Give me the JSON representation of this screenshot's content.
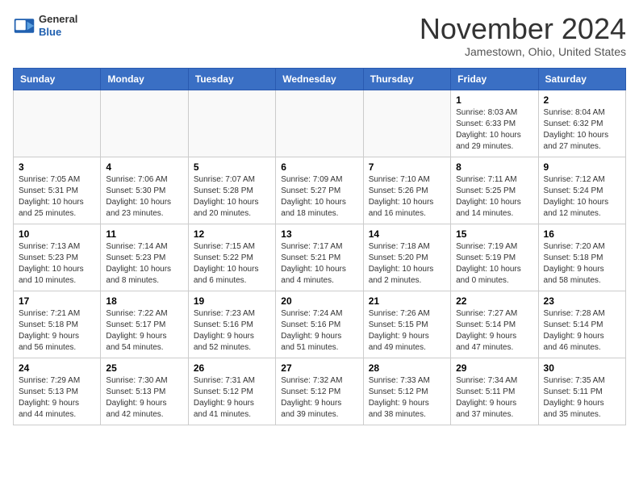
{
  "header": {
    "logo_line1": "General",
    "logo_line2": "Blue",
    "month": "November 2024",
    "location": "Jamestown, Ohio, United States"
  },
  "days_of_week": [
    "Sunday",
    "Monday",
    "Tuesday",
    "Wednesday",
    "Thursday",
    "Friday",
    "Saturday"
  ],
  "weeks": [
    [
      {
        "day": "",
        "info": ""
      },
      {
        "day": "",
        "info": ""
      },
      {
        "day": "",
        "info": ""
      },
      {
        "day": "",
        "info": ""
      },
      {
        "day": "",
        "info": ""
      },
      {
        "day": "1",
        "info": "Sunrise: 8:03 AM\nSunset: 6:33 PM\nDaylight: 10 hours\nand 29 minutes."
      },
      {
        "day": "2",
        "info": "Sunrise: 8:04 AM\nSunset: 6:32 PM\nDaylight: 10 hours\nand 27 minutes."
      }
    ],
    [
      {
        "day": "3",
        "info": "Sunrise: 7:05 AM\nSunset: 5:31 PM\nDaylight: 10 hours\nand 25 minutes."
      },
      {
        "day": "4",
        "info": "Sunrise: 7:06 AM\nSunset: 5:30 PM\nDaylight: 10 hours\nand 23 minutes."
      },
      {
        "day": "5",
        "info": "Sunrise: 7:07 AM\nSunset: 5:28 PM\nDaylight: 10 hours\nand 20 minutes."
      },
      {
        "day": "6",
        "info": "Sunrise: 7:09 AM\nSunset: 5:27 PM\nDaylight: 10 hours\nand 18 minutes."
      },
      {
        "day": "7",
        "info": "Sunrise: 7:10 AM\nSunset: 5:26 PM\nDaylight: 10 hours\nand 16 minutes."
      },
      {
        "day": "8",
        "info": "Sunrise: 7:11 AM\nSunset: 5:25 PM\nDaylight: 10 hours\nand 14 minutes."
      },
      {
        "day": "9",
        "info": "Sunrise: 7:12 AM\nSunset: 5:24 PM\nDaylight: 10 hours\nand 12 minutes."
      }
    ],
    [
      {
        "day": "10",
        "info": "Sunrise: 7:13 AM\nSunset: 5:23 PM\nDaylight: 10 hours\nand 10 minutes."
      },
      {
        "day": "11",
        "info": "Sunrise: 7:14 AM\nSunset: 5:23 PM\nDaylight: 10 hours\nand 8 minutes."
      },
      {
        "day": "12",
        "info": "Sunrise: 7:15 AM\nSunset: 5:22 PM\nDaylight: 10 hours\nand 6 minutes."
      },
      {
        "day": "13",
        "info": "Sunrise: 7:17 AM\nSunset: 5:21 PM\nDaylight: 10 hours\nand 4 minutes."
      },
      {
        "day": "14",
        "info": "Sunrise: 7:18 AM\nSunset: 5:20 PM\nDaylight: 10 hours\nand 2 minutes."
      },
      {
        "day": "15",
        "info": "Sunrise: 7:19 AM\nSunset: 5:19 PM\nDaylight: 10 hours\nand 0 minutes."
      },
      {
        "day": "16",
        "info": "Sunrise: 7:20 AM\nSunset: 5:18 PM\nDaylight: 9 hours\nand 58 minutes."
      }
    ],
    [
      {
        "day": "17",
        "info": "Sunrise: 7:21 AM\nSunset: 5:18 PM\nDaylight: 9 hours\nand 56 minutes."
      },
      {
        "day": "18",
        "info": "Sunrise: 7:22 AM\nSunset: 5:17 PM\nDaylight: 9 hours\nand 54 minutes."
      },
      {
        "day": "19",
        "info": "Sunrise: 7:23 AM\nSunset: 5:16 PM\nDaylight: 9 hours\nand 52 minutes."
      },
      {
        "day": "20",
        "info": "Sunrise: 7:24 AM\nSunset: 5:16 PM\nDaylight: 9 hours\nand 51 minutes."
      },
      {
        "day": "21",
        "info": "Sunrise: 7:26 AM\nSunset: 5:15 PM\nDaylight: 9 hours\nand 49 minutes."
      },
      {
        "day": "22",
        "info": "Sunrise: 7:27 AM\nSunset: 5:14 PM\nDaylight: 9 hours\nand 47 minutes."
      },
      {
        "day": "23",
        "info": "Sunrise: 7:28 AM\nSunset: 5:14 PM\nDaylight: 9 hours\nand 46 minutes."
      }
    ],
    [
      {
        "day": "24",
        "info": "Sunrise: 7:29 AM\nSunset: 5:13 PM\nDaylight: 9 hours\nand 44 minutes."
      },
      {
        "day": "25",
        "info": "Sunrise: 7:30 AM\nSunset: 5:13 PM\nDaylight: 9 hours\nand 42 minutes."
      },
      {
        "day": "26",
        "info": "Sunrise: 7:31 AM\nSunset: 5:12 PM\nDaylight: 9 hours\nand 41 minutes."
      },
      {
        "day": "27",
        "info": "Sunrise: 7:32 AM\nSunset: 5:12 PM\nDaylight: 9 hours\nand 39 minutes."
      },
      {
        "day": "28",
        "info": "Sunrise: 7:33 AM\nSunset: 5:12 PM\nDaylight: 9 hours\nand 38 minutes."
      },
      {
        "day": "29",
        "info": "Sunrise: 7:34 AM\nSunset: 5:11 PM\nDaylight: 9 hours\nand 37 minutes."
      },
      {
        "day": "30",
        "info": "Sunrise: 7:35 AM\nSunset: 5:11 PM\nDaylight: 9 hours\nand 35 minutes."
      }
    ]
  ]
}
